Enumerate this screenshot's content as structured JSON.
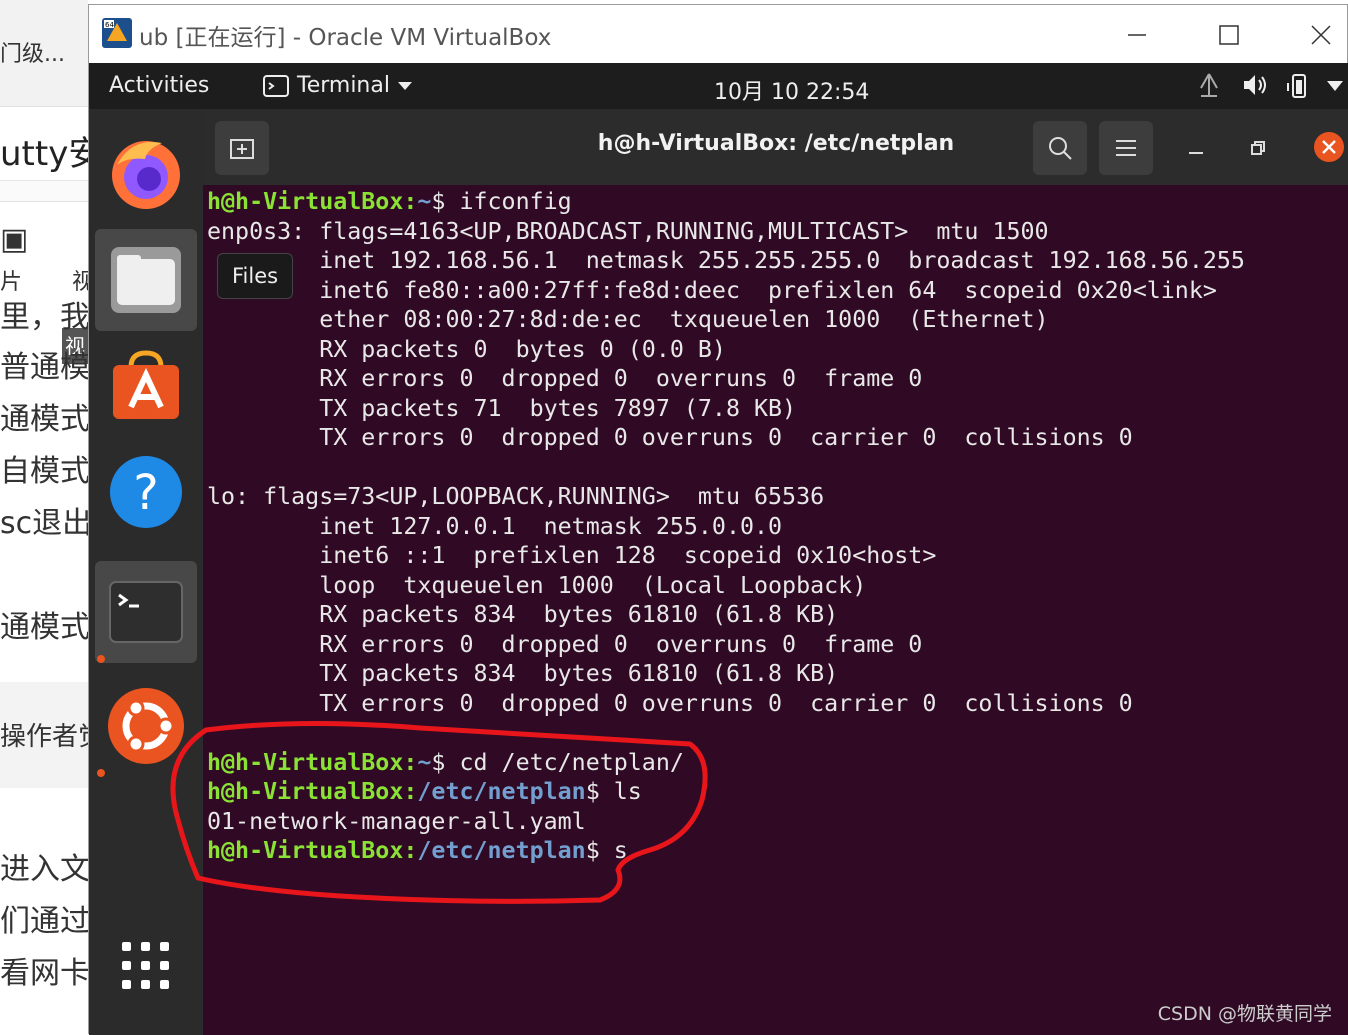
{
  "background_page": {
    "tab_text": "门级...",
    "heading_text": "utty安",
    "tab_icon_label_1": "片",
    "tab_icon_label_2": "视",
    "side_tag": "视",
    "lines": [
      "里，我",
      "普通模",
      "通模式",
      "自模式",
      "sc退出",
      "通模式",
      "操作者觉",
      "进入文",
      "们通过",
      "看网卡"
    ]
  },
  "vbox": {
    "title": "ub [正在运行] - Oracle VM VirtualBox",
    "controls": {
      "minimize_icon": "minimize-icon",
      "maximize_icon": "maximize-icon",
      "close_icon": "close-icon"
    }
  },
  "topbar": {
    "activities": "Activities",
    "app_menu": "Terminal",
    "clock": "10月 10  22:54"
  },
  "dock": {
    "items": [
      "firefox",
      "files",
      "ubuntu-software",
      "help",
      "terminal",
      "ubuntu-logo",
      "show-applications"
    ],
    "tooltip": "Files"
  },
  "terminal": {
    "title": "h@h-VirtualBox: /etc/netplan",
    "lines": [
      {
        "user": "h@h-VirtualBox:",
        "path": "~",
        "cmd": "$ ifconfig"
      },
      {
        "text": "enp0s3: flags=4163<UP,BROADCAST,RUNNING,MULTICAST>  mtu 1500"
      },
      {
        "text": "        inet 192.168.56.1  netmask 255.255.255.0  broadcast 192.168.56.255"
      },
      {
        "text": "        inet6 fe80::a00:27ff:fe8d:deec  prefixlen 64  scopeid 0x20<link>"
      },
      {
        "text": "        ether 08:00:27:8d:de:ec  txqueuelen 1000  (Ethernet)"
      },
      {
        "text": "        RX packets 0  bytes 0 (0.0 B)"
      },
      {
        "text": "        RX errors 0  dropped 0  overruns 0  frame 0"
      },
      {
        "text": "        TX packets 71  bytes 7897 (7.8 KB)"
      },
      {
        "text": "        TX errors 0  dropped 0 overruns 0  carrier 0  collisions 0"
      },
      {
        "text": ""
      },
      {
        "text": "lo: flags=73<UP,LOOPBACK,RUNNING>  mtu 65536"
      },
      {
        "text": "        inet 127.0.0.1  netmask 255.0.0.0"
      },
      {
        "text": "        inet6 ::1  prefixlen 128  scopeid 0x10<host>"
      },
      {
        "text": "        loop  txqueuelen 1000  (Local Loopback)"
      },
      {
        "text": "        RX packets 834  bytes 61810 (61.8 KB)"
      },
      {
        "text": "        RX errors 0  dropped 0  overruns 0  frame 0"
      },
      {
        "text": "        TX packets 834  bytes 61810 (61.8 KB)"
      },
      {
        "text": "        TX errors 0  dropped 0 overruns 0  carrier 0  collisions 0"
      },
      {
        "text": ""
      },
      {
        "user": "h@h-VirtualBox:",
        "path": "~",
        "cmd": "$ cd /etc/netplan/"
      },
      {
        "user": "h@h-VirtualBox:",
        "path": "/etc/netplan",
        "cmd": "$ ls"
      },
      {
        "text": "01-network-manager-all.yaml"
      },
      {
        "user": "h@h-VirtualBox:",
        "path": "/etc/netplan",
        "cmd": "$ s"
      }
    ]
  },
  "annotation": {
    "color": "#e8161b"
  },
  "watermark": "CSDN @物联黄同学"
}
